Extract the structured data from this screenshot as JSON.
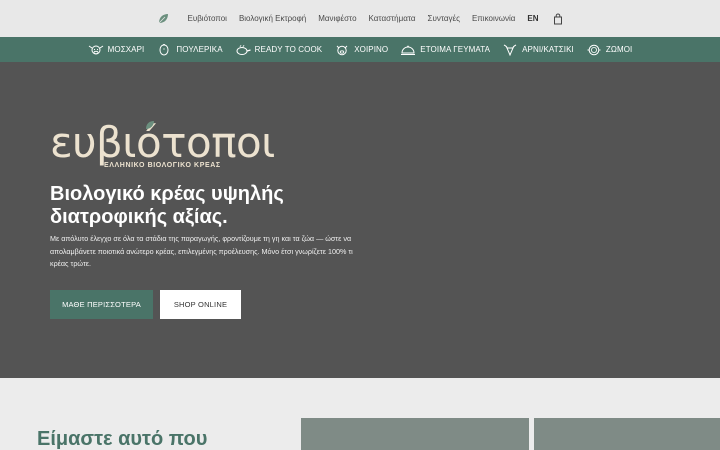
{
  "topnav": {
    "items": [
      "Ευβιότοποι",
      "Βιολογική Εκτροφή",
      "Μανιφέστο",
      "Καταστήματα",
      "Συνταγές",
      "Επικοινωνία"
    ],
    "lang": "EN",
    "leaf_icon": "leaf-icon",
    "bag_icon": "shopping-bag-icon"
  },
  "categories": [
    {
      "label": "ΜΟΣΧΑΡΙ",
      "icon": "cow-icon"
    },
    {
      "label": "ΠΟΥΛΕΡΙΚΑ",
      "icon": "chicken-icon"
    },
    {
      "label": "READY TO COOK",
      "icon": "pan-icon"
    },
    {
      "label": "ΧΟΙΡΙΝΟ",
      "icon": "pig-icon"
    },
    {
      "label": "ΕΤΟΙΜΑ ΓΕΥΜΑΤΑ",
      "icon": "dish-icon"
    },
    {
      "label": "ΑΡΝΙ/ΚΑΤΣΙΚΙ",
      "icon": "lamb-icon"
    },
    {
      "label": "ΖΩΜΟΙ",
      "icon": "broth-icon"
    }
  ],
  "hero": {
    "logo_word": "ευβιότοποι",
    "logo_sub": "ΕΛΛΗΝΙΚΟ ΒΙΟΛΟΓΙΚΟ ΚΡΕΑΣ",
    "title": "Βιολογικό κρέας υψηλής διατροφικής αξίας.",
    "text": "Με απόλυτο έλεγχο σε όλα τα στάδια της παραγωγής, φροντίζουμε τη γη και τα ζώα — ώστε να απολαμβάνετε ποιοτικά ανώτερο κρέας, επιλεγμένης προέλευσης. Μόνο έτσι γνωρίζετε 100% τι κρέας τρώτε.",
    "primary_button": "ΜΑΘΕ ΠΕΡΙΣΣΟΤΕΡΑ",
    "secondary_button": "SHOP ONLINE"
  },
  "lower": {
    "heading": "Είμαστε αυτό που"
  },
  "colors": {
    "accent": "#4a7468",
    "hero_bg": "#545454",
    "logo": "#ece2cf"
  }
}
